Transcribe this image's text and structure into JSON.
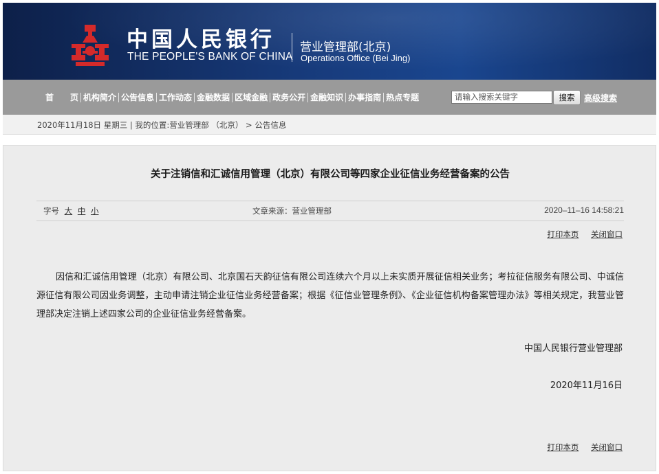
{
  "header": {
    "logo_cn": "中国人民银行",
    "logo_en": "THE PEOPLE'S BANK OF CHINA",
    "office_cn": "营业管理部(北京)",
    "office_en": "Operations Office (Bei Jing)",
    "emblem_color": "#d42a2a"
  },
  "nav": {
    "items": [
      "首　　页",
      "机构简介",
      "公告信息",
      "工作动态",
      "金融数据",
      "区域金融",
      "政务公开",
      "金融知识",
      "办事指南",
      "热点专题"
    ],
    "search_placeholder": "请输入搜索关键字",
    "search_button": "搜索",
    "advanced_search": "高级搜索"
  },
  "breadcrumb": "2020年11月18日  星期三 | 我的位置:营业管理部 （北京） > 公告信息",
  "article": {
    "title": "关于注销信和汇诚信用管理（北京）有限公司等四家企业征信业务经营备案的公告",
    "font_size_label": "字号",
    "font_size_options": [
      "大",
      "中",
      "小"
    ],
    "source": "文章来源：营业管理部",
    "datetime": "2020–11–16 14:58:21",
    "print_label": "打印本页",
    "close_label": "关闭窗口",
    "body": "因信和汇诚信用管理（北京）有限公司、北京国石天韵征信有限公司连续六个月以上未实质开展征信相关业务；考拉征信服务有限公司、中诚信源征信有限公司因业务调整，主动申请注销企业征信业务经营备案；根据《征信业管理条例》、《企业征信机构备案管理办法》等相关规定，我营业管理部决定注销上述四家公司的企业征信业务经营备案。",
    "signature": "中国人民银行营业管理部",
    "date": "2020年11月16日"
  },
  "colors": {
    "banner": "#173a7a",
    "nav_bg": "#9a9a9a",
    "panel_bg": "#ececec"
  }
}
